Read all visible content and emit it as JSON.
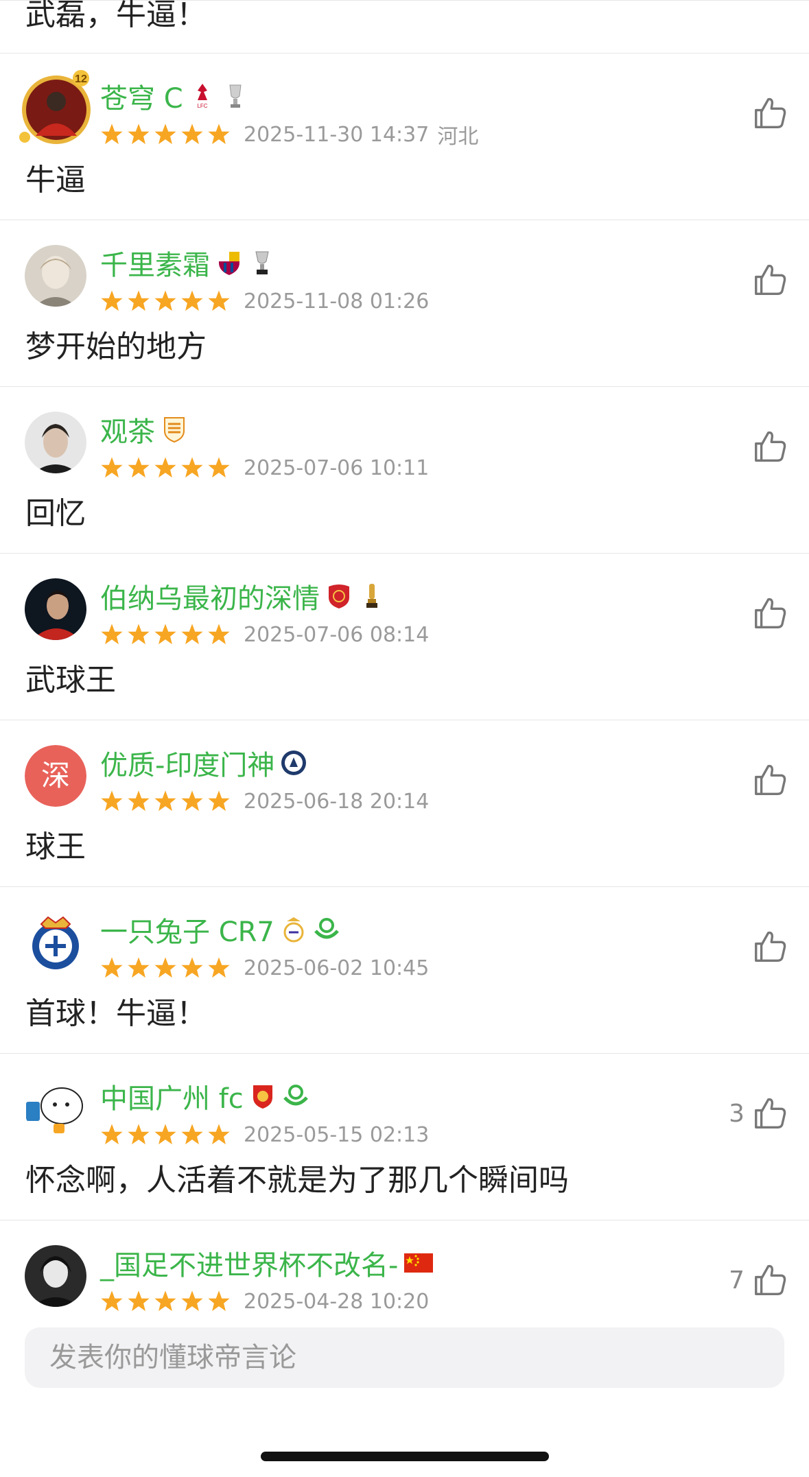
{
  "colors": {
    "username": "#3bb54a",
    "star": "#f7a623",
    "meta": "#9a9a9a",
    "like_icon": "#777777",
    "avatar_text_bg": "#e8625a"
  },
  "top_partial": {
    "text": "武磊，牛逼！"
  },
  "comments": [
    {
      "username": "苍穹 C",
      "rating": 5,
      "date": "2025-11-30 14:37",
      "location": "河北",
      "text": "牛逼",
      "likes": "",
      "avatar_icon": "footballer-photo-avatar-level-12",
      "badges": [
        "liverpool-crest-icon",
        "premier-league-trophy-icon"
      ]
    },
    {
      "username": "千里素霜",
      "rating": 5,
      "date": "2025-11-08 01:26",
      "location": "",
      "text": "梦开始的地方",
      "likes": "",
      "avatar_icon": "portrait-photo-avatar",
      "badges": [
        "barcelona-crest-icon",
        "laliga-trophy-icon"
      ]
    },
    {
      "username": "观茶",
      "rating": 5,
      "date": "2025-07-06 10:11",
      "location": "",
      "text": "回忆",
      "likes": "",
      "avatar_icon": "portrait-photo-avatar",
      "badges": [
        "shandong-taishan-crest-icon"
      ]
    },
    {
      "username": "伯纳乌最初的深情",
      "rating": 5,
      "date": "2025-07-06 08:14",
      "location": "",
      "text": "武球王",
      "likes": "",
      "avatar_icon": "player-photo-avatar",
      "badges": [
        "shanghai-port-crest-icon",
        "trophy-icon"
      ]
    },
    {
      "username": "优质-印度门神",
      "rating": 5,
      "date": "2025-06-18 20:14",
      "location": "",
      "text": "球王",
      "likes": "",
      "avatar_icon": "text-avatar",
      "avatar_text": "深",
      "badges": [
        "club-crest-icon"
      ]
    },
    {
      "username": "一只兔子 CR7",
      "rating": 5,
      "date": "2025-06-02 10:45",
      "location": "",
      "text": "首球！牛逼！",
      "likes": "",
      "avatar_icon": "espanyol-crest-avatar",
      "badges": [
        "real-madrid-crest-icon",
        "fan-badge-icon"
      ]
    },
    {
      "username": "中国广州 fc",
      "rating": 5,
      "date": "2025-05-15 02:13",
      "location": "",
      "text": "怀念啊，人活着不就是为了那几个瞬间吗",
      "likes": "3",
      "avatar_icon": "cartoon-avatar",
      "badges": [
        "guangzhou-fc-crest-icon",
        "fan-badge-icon"
      ]
    },
    {
      "username": "_国足不进世界杯不改名-",
      "rating": 5,
      "date": "2025-04-28 10:20",
      "location": "",
      "text": "",
      "likes": "7",
      "avatar_icon": "dark-silhouette-avatar",
      "badges": [
        "china-flag-icon"
      ]
    }
  ],
  "input": {
    "placeholder": "发表你的懂球帝言论",
    "value": ""
  }
}
